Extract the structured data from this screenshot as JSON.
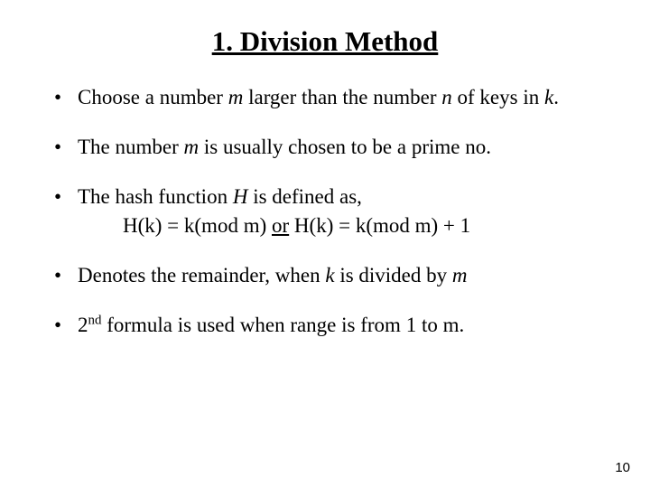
{
  "title": "1. Division Method",
  "bullets": {
    "b1": {
      "pre": "Choose a number ",
      "m": "m",
      "mid": " larger than the number ",
      "n": "n",
      "post1": " of  keys in  ",
      "k": "k",
      "dot": "."
    },
    "b2": {
      "pre": "The number ",
      "m": "m",
      "post": "  is usually chosen to be a prime no."
    },
    "b3": {
      "line1a": "The hash function ",
      "H": "H",
      "line1b": "  is defined as,",
      "formulaA": "H(k) = k(mod m)   ",
      "or": "or",
      "formulaB": "   H(k) = k(mod m) + 1"
    },
    "b4": {
      "pre": "Denotes the remainder, when ",
      "k": "k",
      "mid": " is divided by ",
      "m": "m"
    },
    "b5": {
      "two": "2",
      "nd": "nd",
      "post": " formula is used when range is from 1 to m."
    }
  },
  "pageNumber": "10"
}
